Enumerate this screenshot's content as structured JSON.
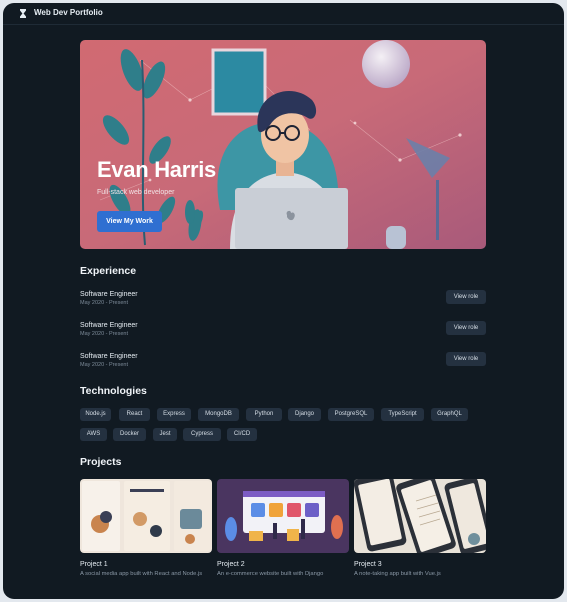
{
  "app": {
    "title": "Web Dev Portfolio",
    "icon": "hourglass-icon"
  },
  "hero": {
    "name": "Evan Harris",
    "subtitle": "Full-stack web developer",
    "cta": "View My Work"
  },
  "sections": {
    "experience": "Experience",
    "technologies": "Technologies",
    "projects": "Projects"
  },
  "experience": [
    {
      "role": "Software Engineer",
      "date": "May 2020 - Present",
      "button": "View role"
    },
    {
      "role": "Software Engineer",
      "date": "May 2020 - Present",
      "button": "View role"
    },
    {
      "role": "Software Engineer",
      "date": "May 2020 - Present",
      "button": "View role"
    }
  ],
  "technologies": [
    "Node.js",
    "React",
    "Express",
    "MongoDB",
    "Python",
    "Django",
    "PostgreSQL",
    "TypeScript",
    "GraphQL",
    "AWS",
    "Docker",
    "Jest",
    "Cypress",
    "CI/CD"
  ],
  "projects": [
    {
      "title": "Project 1",
      "description": "A social media app built with React and Node.js"
    },
    {
      "title": "Project 2",
      "description": "An e-commerce website built with Django"
    },
    {
      "title": "Project 3",
      "description": "A note-taking app built with Vue.js"
    }
  ],
  "colors": {
    "background": "#111a22",
    "accent": "#2f6fd1",
    "chip": "#243140"
  }
}
